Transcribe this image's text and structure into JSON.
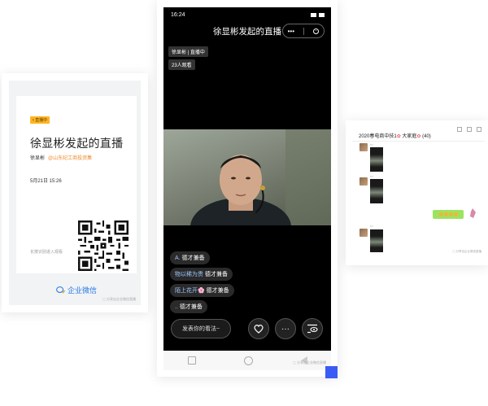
{
  "share_poster": {
    "badge": "• 直播中",
    "title": "徐显彬发起的直播",
    "host": "徐显彬",
    "org": "@山东纪工商投资集",
    "date": "5月21日 15:26",
    "scan_hint": "长按识别进入观看",
    "brand": "企业微信",
    "footer_note": "▢ 分享自企业微信直播"
  },
  "phone": {
    "status_time": "16:24",
    "live_title": "徐显彬发起的直播",
    "capsule_more": "•••",
    "host_tag": "徐显彬 | 直播中",
    "viewers_tag": "23人观看",
    "comments": [
      {
        "nick": "A.",
        "text": "德才兼备"
      },
      {
        "nick": "物以稀为贵",
        "text": "德才兼备"
      },
      {
        "nick": "陌上花开🌸",
        "text": "德才兼备"
      },
      {
        "nick": "..",
        "text": "德才兼备"
      }
    ],
    "input_placeholder": "发表你的看法~",
    "more_icon": "···",
    "footer_note": "▢ 分享自企业微信直播"
  },
  "group_chat": {
    "title": "2020春电商中技1",
    "title_suffix": "大家庭",
    "member_count": "(40)",
    "footer_note": "▢ 分享自企业微信直播"
  },
  "colors": {
    "brand_blue": "#2b78e4",
    "badge_yellow": "#ffb520",
    "host_org": "#f08a2b",
    "chat_green": "#9de35f",
    "accent_square": "#3a5cf5"
  }
}
